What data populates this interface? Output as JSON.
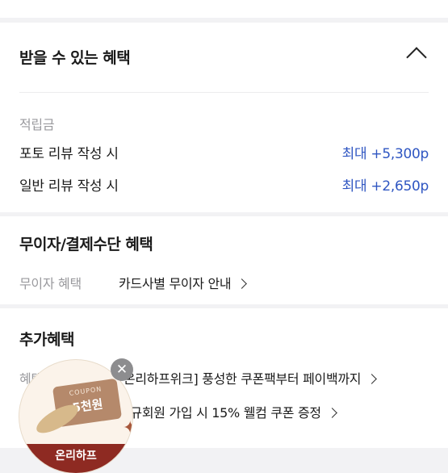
{
  "benefits": {
    "title": "받을 수 있는 혜택",
    "points": {
      "label": "적립금",
      "rows": [
        {
          "label": "포토 리뷰 작성 시",
          "value": "최대 +5,300p"
        },
        {
          "label": "일반 리뷰 작성 시",
          "value": "최대 +2,650p"
        }
      ]
    }
  },
  "installment": {
    "title": "무이자/결제수단 혜택",
    "label": "무이자 혜택",
    "link": "카드사별 무이자 안내"
  },
  "extra": {
    "title": "추가혜택",
    "label": "혜택",
    "items": [
      "[온리하프위크] 풍성한 쿠폰팩부터 페이백까지",
      "신규회원 가입 시 15% 웰컴 쿠폰 증정"
    ]
  },
  "coupon_popup": {
    "tag_small": "COUPON",
    "tag_big": "5천원",
    "band_text": "온리하프"
  },
  "icons": {
    "collapse": "chevron-up-icon",
    "arrow": "chevron-right-icon",
    "close": "close-icon"
  }
}
